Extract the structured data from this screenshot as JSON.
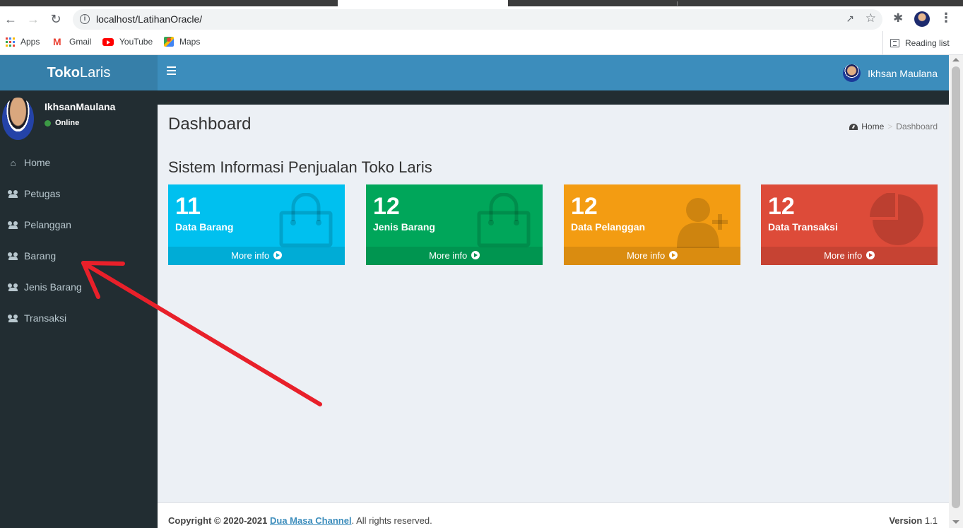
{
  "browser": {
    "url": "localhost/LatihanOracle/",
    "bookmarks": [
      {
        "label": "Apps",
        "icon": "apps-grid-icon"
      },
      {
        "label": "Gmail",
        "icon": "gmail-icon"
      },
      {
        "label": "YouTube",
        "icon": "youtube-icon"
      },
      {
        "label": "Maps",
        "icon": "maps-icon"
      }
    ],
    "reading_list": "Reading list"
  },
  "header": {
    "logo_bold": "Toko",
    "logo_light": "Laris",
    "user_name": "Ikhsan Maulana"
  },
  "sidebar": {
    "user_name": "IkhsanMaulana",
    "status": "Online",
    "items": [
      {
        "label": "Home",
        "icon": "home-icon"
      },
      {
        "label": "Petugas",
        "icon": "users-icon"
      },
      {
        "label": "Pelanggan",
        "icon": "users-icon"
      },
      {
        "label": "Barang",
        "icon": "users-icon"
      },
      {
        "label": "Jenis Barang",
        "icon": "users-icon"
      },
      {
        "label": "Transaksi",
        "icon": "users-icon"
      }
    ]
  },
  "main": {
    "title": "Dashboard",
    "breadcrumb": {
      "home": "Home",
      "current": "Dashboard"
    },
    "section_title": "Sistem Informasi Penjualan Toko Laris",
    "boxes": [
      {
        "number": "11",
        "label": "Data Barang",
        "footer": "More info",
        "color": "#00c0ef",
        "icon": "shopping-bag-icon"
      },
      {
        "number": "12",
        "label": "Jenis Barang",
        "footer": "More info",
        "color": "#00a65a",
        "icon": "shopping-bag-icon"
      },
      {
        "number": "12",
        "label": "Data Pelanggan",
        "footer": "More info",
        "color": "#f39c12",
        "icon": "user-plus-icon"
      },
      {
        "number": "12",
        "label": "Data Transaksi",
        "footer": "More info",
        "color": "#dd4b39",
        "icon": "pie-chart-icon"
      }
    ]
  },
  "footer": {
    "copyright": "Copyright © 2020-2021",
    "link": "Dua Masa Channel",
    "rights": ". All rights reserved.",
    "version_label": "Version",
    "version": "1.1"
  },
  "colors": {
    "header": "#3c8dbc",
    "logo_bg": "#367fa9",
    "sidebar": "#222d32",
    "annotation_arrow": "#e8202a"
  }
}
